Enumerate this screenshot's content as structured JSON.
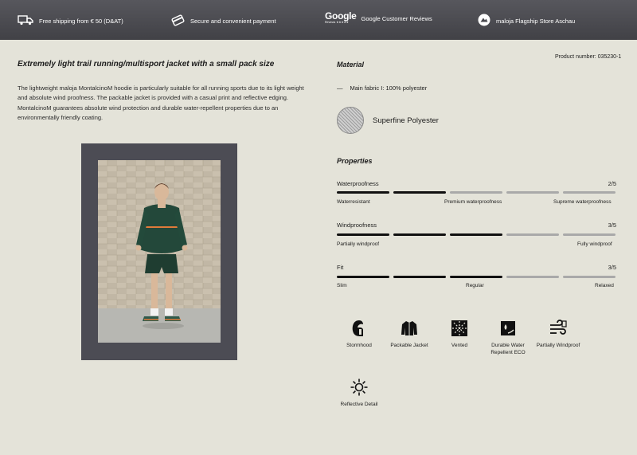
{
  "topbar": {
    "items": [
      {
        "icon": "delivery-truck-icon",
        "text": "Free shipping from € 50 (D&AT)"
      },
      {
        "icon": "credit-card-icon",
        "text": "Secure and convenient payment"
      },
      {
        "icon": "google-logo-icon",
        "logo": "Google",
        "logo_sub": "Reviews ★★★★★",
        "text": "Google Customer Reviews"
      },
      {
        "icon": "maloja-logo-icon",
        "text": "maloja Flagship Store Aschau"
      }
    ]
  },
  "product": {
    "headline": "Extremely light trail running/multisport jacket with a small pack size",
    "description": "The lightweight maloja MontalcinoM hoodie is particularly suitable for all running sports due to its light weight and absolute wind proofness. The packable jacket is provided with a casual print and reflective edging. MontalcinoM guarantees absolute wind protection and durable water-repellent properties due to an environmentally friendly coating.",
    "number": "Product number: 035230-1"
  },
  "material": {
    "title": "Material",
    "dash": "—",
    "fabric": "Main fabric I: 100% polyester",
    "swatch_label": "Superfine Polyester"
  },
  "properties": {
    "title": "Properties",
    "items": [
      {
        "label": "Waterproofness",
        "value": "2/5",
        "level": 2,
        "scale": [
          "Waterresistant",
          "Premium waterproofness",
          "Supreme waterproofness"
        ]
      },
      {
        "label": "Windproofness",
        "value": "3/5",
        "level": 3,
        "scale": [
          "Partially windproof",
          "Fully windproof"
        ]
      },
      {
        "label": "Fit",
        "value": "3/5",
        "level": 3,
        "scale": [
          "Slim",
          "Regular",
          "Relaxed"
        ]
      }
    ]
  },
  "features": [
    {
      "icon": "stormhood-icon",
      "label": "Stormhood"
    },
    {
      "icon": "packable-jacket-icon",
      "label": "Packable Jacket"
    },
    {
      "icon": "vented-icon",
      "label": "Vented"
    },
    {
      "icon": "durable-water-repellent-icon",
      "label": "Durable Water Repellent ECO"
    },
    {
      "icon": "partially-windproof-icon",
      "label": "Partially Windproof"
    },
    {
      "icon": "reflective-detail-icon",
      "label": "Reflective Detail"
    }
  ],
  "colors": {
    "topbar": "#4a4a50",
    "background": "#e4e3d9",
    "bar_active": "#111111",
    "bar_inactive": "#a9a9a9",
    "jacket": "#23483a"
  }
}
